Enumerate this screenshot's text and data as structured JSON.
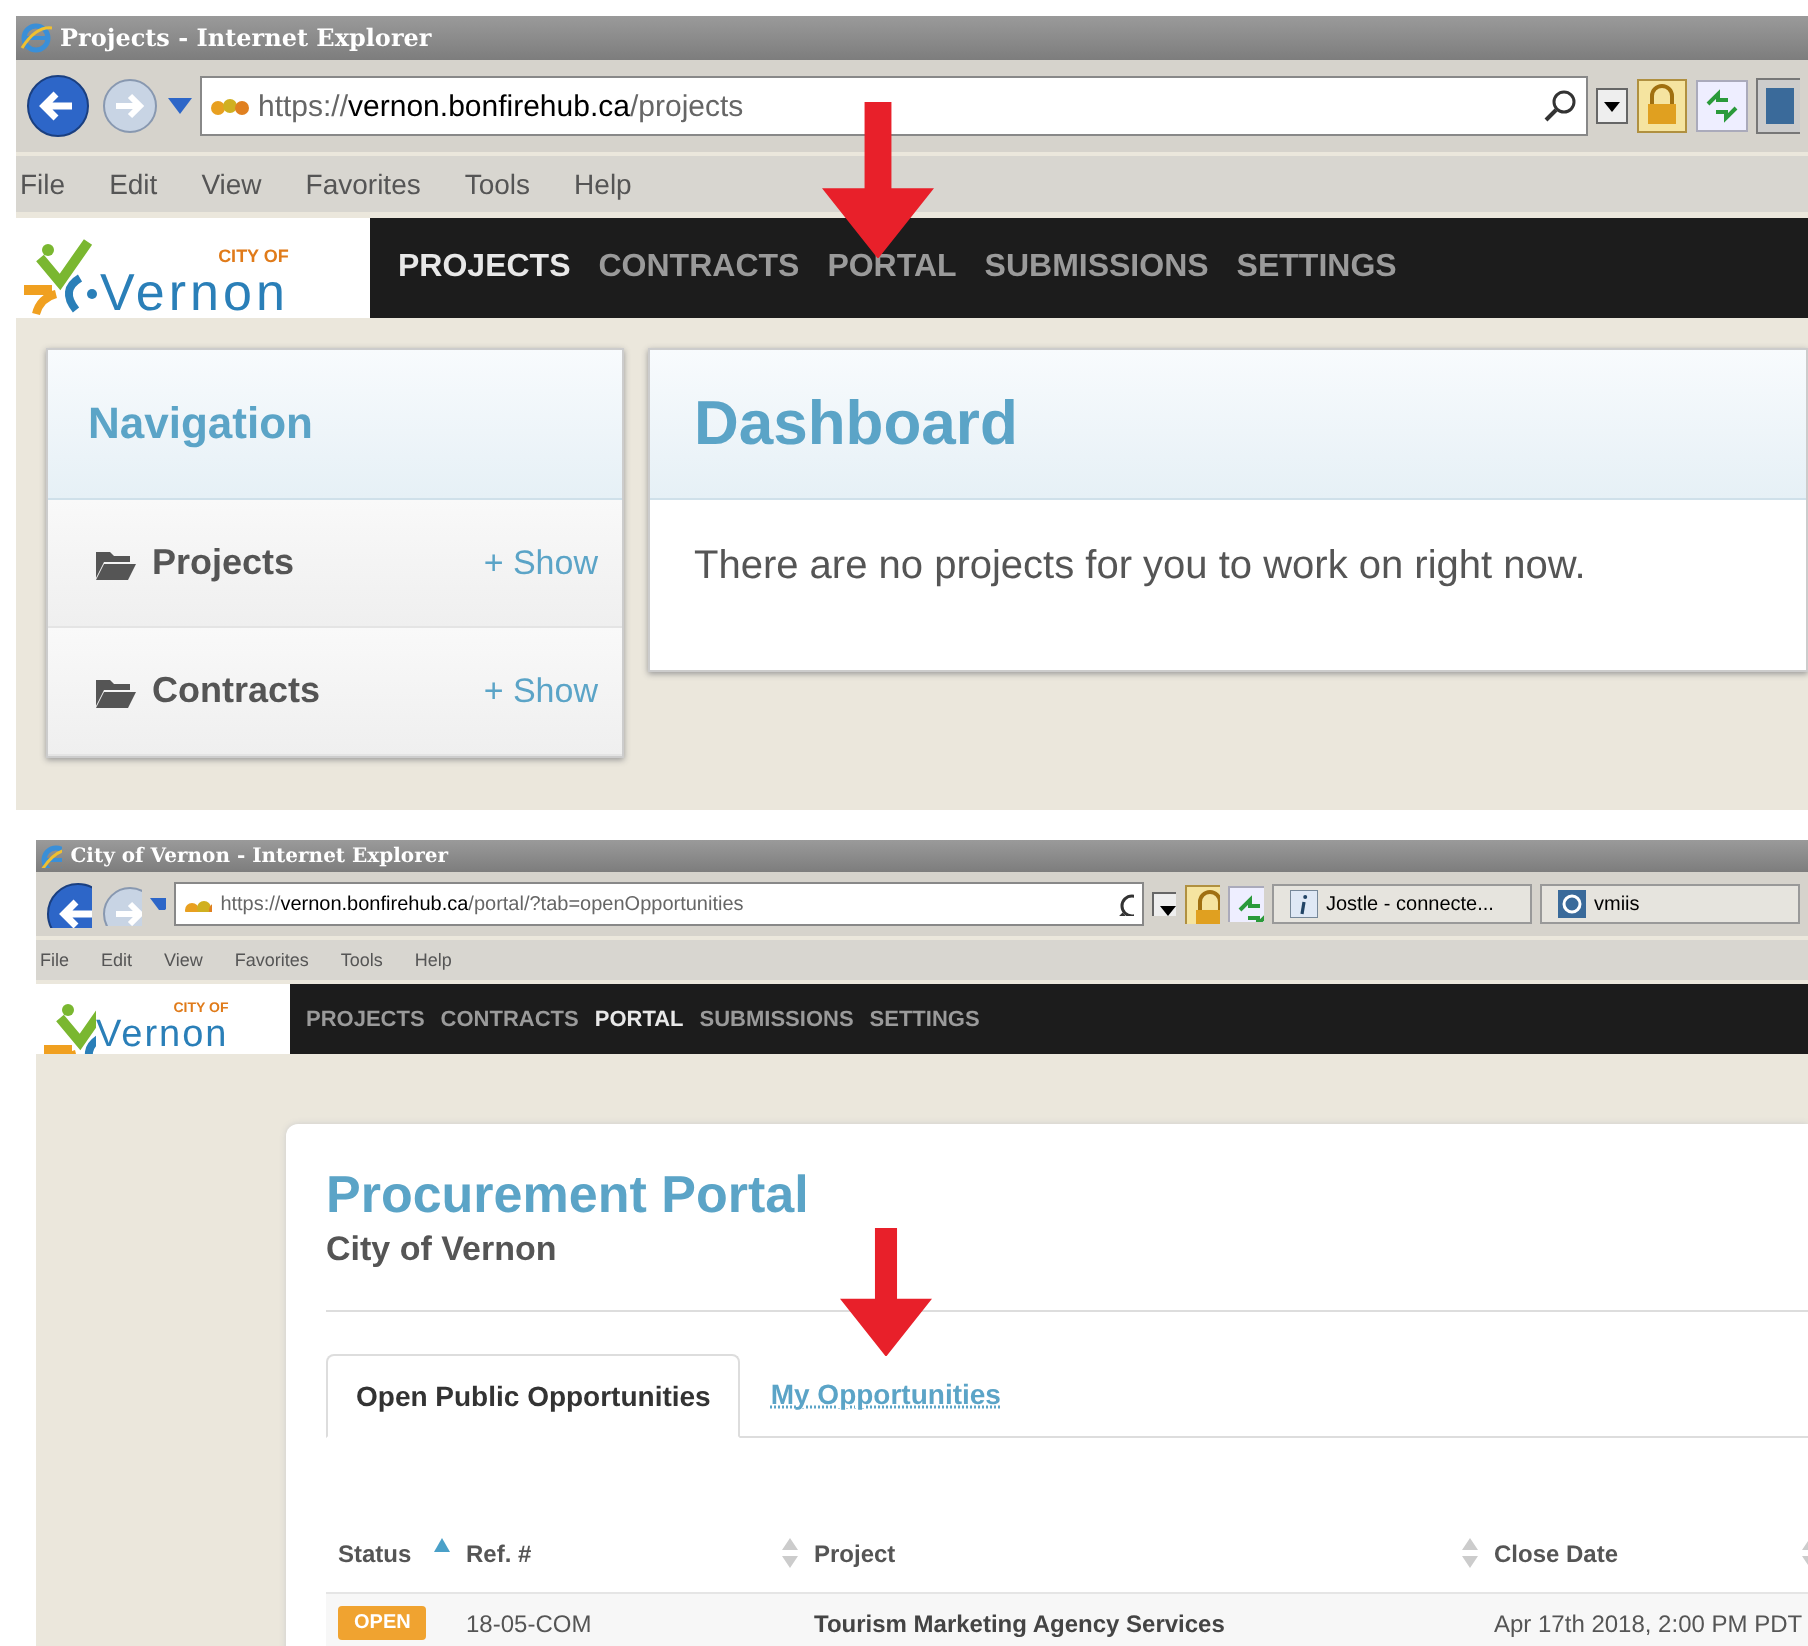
{
  "screenshots": [
    {
      "browser": {
        "title": "Projects - Internet Explorer",
        "url": {
          "scheme": "https://",
          "host": "vernon.bonfirehub.ca",
          "path": "/projects"
        },
        "menu": [
          "File",
          "Edit",
          "View",
          "Favorites",
          "Tools",
          "Help"
        ]
      },
      "logo": {
        "small": "CITY OF",
        "name": "Vernon"
      },
      "site_nav": [
        {
          "label": "PROJECTS",
          "selected": true,
          "arrow": false
        },
        {
          "label": "CONTRACTS",
          "selected": false,
          "arrow": false
        },
        {
          "label": "PORTAL",
          "selected": false,
          "arrow": true
        },
        {
          "label": "SUBMISSIONS",
          "selected": false,
          "arrow": false
        },
        {
          "label": "SETTINGS",
          "selected": false,
          "arrow": false
        }
      ],
      "kind": "dashboard",
      "sidebar": {
        "title": "Navigation",
        "items": [
          {
            "label": "Projects",
            "action": "+ Show"
          },
          {
            "label": "Contracts",
            "action": "+ Show"
          }
        ]
      },
      "main": {
        "title": "Dashboard",
        "message": "There are no projects for you to work on right now."
      }
    },
    {
      "browser": {
        "title": "City of Vernon - Internet Explorer",
        "url": {
          "scheme": "https://",
          "host": "vernon.bonfirehub.ca",
          "path": "/portal/?tab=openOpportunities"
        },
        "tabs": [
          "Jostle - connecte...",
          "vmiis"
        ],
        "menu": [
          "File",
          "Edit",
          "View",
          "Favorites",
          "Tools",
          "Help"
        ]
      },
      "logo": {
        "small": "CITY OF",
        "name": "Vernon"
      },
      "site_nav": [
        {
          "label": "PROJECTS",
          "selected": false,
          "arrow": false
        },
        {
          "label": "CONTRACTS",
          "selected": false,
          "arrow": false
        },
        {
          "label": "PORTAL",
          "selected": true,
          "arrow": false
        },
        {
          "label": "SUBMISSIONS",
          "selected": false,
          "arrow": false
        },
        {
          "label": "SETTINGS",
          "selected": false,
          "arrow": false
        }
      ],
      "kind": "portal",
      "portal": {
        "title": "Procurement Portal",
        "subtitle": "City of Vernon",
        "tabs": [
          {
            "label": "Open Public Opportunities",
            "selected": true,
            "arrow": false
          },
          {
            "label": "My Opportunities",
            "selected": false,
            "arrow": true
          }
        ],
        "table": {
          "columns": [
            {
              "label": "Status",
              "sorted": true
            },
            {
              "label": "Ref. #",
              "sorted": false
            },
            {
              "label": "Project",
              "sorted": false
            },
            {
              "label": "Close Date",
              "sorted": false
            }
          ],
          "rows": [
            {
              "status": "OPEN",
              "ref": "18-05-COM",
              "project": "Tourism Marketing Agency Services",
              "close_date": "Apr 17th 2018, 2:00 PM PDT"
            }
          ]
        }
      }
    }
  ]
}
